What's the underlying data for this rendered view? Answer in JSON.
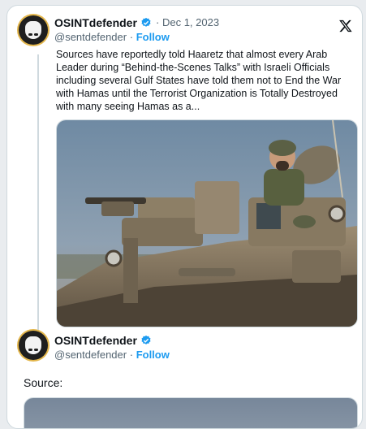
{
  "tweet1": {
    "author_name": "OSINTdefender",
    "separator": "·",
    "date": "Dec 1, 2023",
    "handle": "@sentdefender",
    "follow_label": "Follow",
    "text": "Sources have reportedly told Haaretz that almost every Arab Leader during “Behind-the-Scenes Talks” with Israeli Officials including several Gulf States have told them not to End the War with Hamas until the Terrorist Organization is Totally Destroyed with many seeing Hamas as a..."
  },
  "tweet2": {
    "author_name": "OSINTdefender",
    "handle": "@sentdefender",
    "follow_label": "Follow",
    "text": "Source:"
  },
  "icons": {
    "verified": "verified-badge-icon",
    "platform": "x-logo-icon"
  },
  "colors": {
    "link_blue": "#1d9bf0",
    "text_primary": "#0f1419",
    "text_secondary": "#536471",
    "avatar_ring": "#e3b64b"
  }
}
